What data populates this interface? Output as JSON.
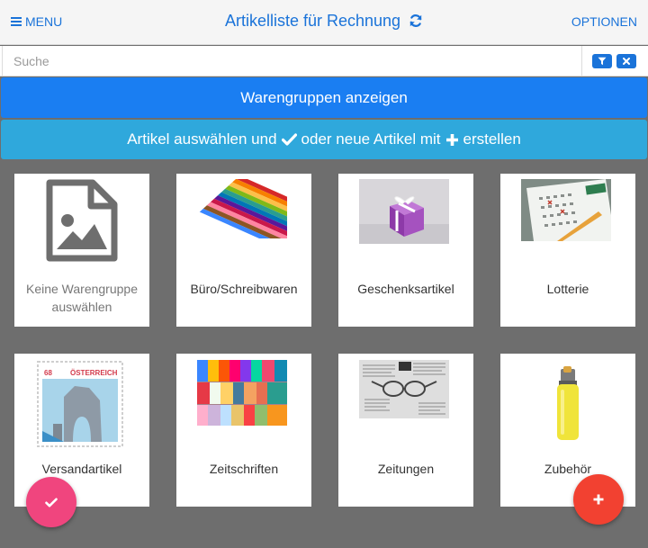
{
  "header": {
    "menu_label": "MENU",
    "title": "Artikelliste für Rechnung",
    "options_label": "OPTIONEN"
  },
  "search": {
    "placeholder": "Suche"
  },
  "groups_button": {
    "label": "Warengruppen anzeigen"
  },
  "hint": {
    "part1": "Artikel auswählen und",
    "part2": "oder neue Artikel mit",
    "part3": "erstellen"
  },
  "tiles": [
    {
      "label": "Keine Warengruppe auswählen",
      "icon": "image-file-icon"
    },
    {
      "label": "Büro/Schreibwaren",
      "icon": "colored-pencils-image"
    },
    {
      "label": "Geschenksartikel",
      "icon": "gift-box-image"
    },
    {
      "label": "Lotterie",
      "icon": "lottery-ticket-image"
    },
    {
      "label": "Versandartikel",
      "icon": "postage-stamp-image",
      "stamp_value": "68",
      "stamp_country": "ÖSTERREICH"
    },
    {
      "label": "Zeitschriften",
      "icon": "magazines-image"
    },
    {
      "label": "Zeitungen",
      "icon": "newspapers-image"
    },
    {
      "label": "Zubehör",
      "icon": "lighter-image"
    }
  ],
  "colors": {
    "accent": "#1a73d9",
    "groups_button": "#1a7ef2",
    "hint_bar": "#2fa8dc",
    "background": "#6e6e6e",
    "fab_check": "#f0457e",
    "fab_add": "#f24131"
  }
}
